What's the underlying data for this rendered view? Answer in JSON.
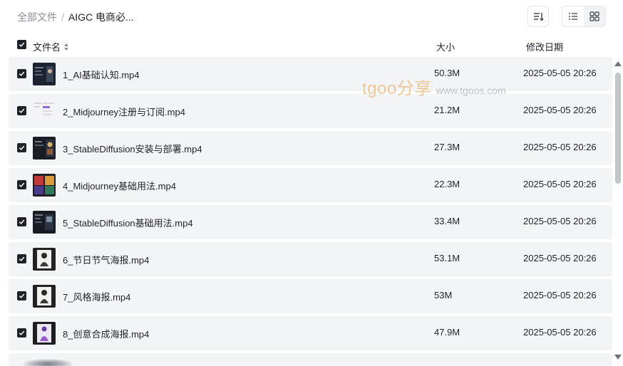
{
  "breadcrumb": {
    "root": "全部文件",
    "separator": "/",
    "current": "AIGC 电商必..."
  },
  "toolbar": {
    "sort_icon": "sort-icon",
    "list_view_icon": "list-view-icon",
    "grid_view_icon": "grid-view-icon",
    "active_view": "list"
  },
  "header": {
    "name": "文件名",
    "size": "大小",
    "date": "修改日期"
  },
  "files": [
    {
      "name": "1_AI基础认知.mp4",
      "size": "50.3M",
      "date": "2025-05-05 20:26",
      "checked": true
    },
    {
      "name": "2_Midjourney注册与订阅.mp4",
      "size": "21.2M",
      "date": "2025-05-05 20:26",
      "checked": true
    },
    {
      "name": "3_StableDiffusion安装与部署.mp4",
      "size": "27.3M",
      "date": "2025-05-05 20:26",
      "checked": true
    },
    {
      "name": "4_Midjourney基础用法.mp4",
      "size": "22.3M",
      "date": "2025-05-05 20:26",
      "checked": true
    },
    {
      "name": "5_StableDiffusion基础用法.mp4",
      "size": "33.4M",
      "date": "2025-05-05 20:26",
      "checked": true
    },
    {
      "name": "6_节日节气海报.mp4",
      "size": "53.1M",
      "date": "2025-05-05 20:26",
      "checked": true
    },
    {
      "name": "7_风格海报.mp4",
      "size": "53M",
      "date": "2025-05-05 20:26",
      "checked": true
    },
    {
      "name": "8_创意合成海报.mp4",
      "size": "47.9M",
      "date": "2025-05-05 20:26",
      "checked": true
    }
  ],
  "watermark": {
    "brand": "tgoo分享",
    "url": "www.tgoos.com"
  },
  "colors": {
    "row_bg": "#f3f4f6",
    "checkbox": "#1f2329",
    "text": "#1f2329",
    "muted": "#8a8f99"
  }
}
